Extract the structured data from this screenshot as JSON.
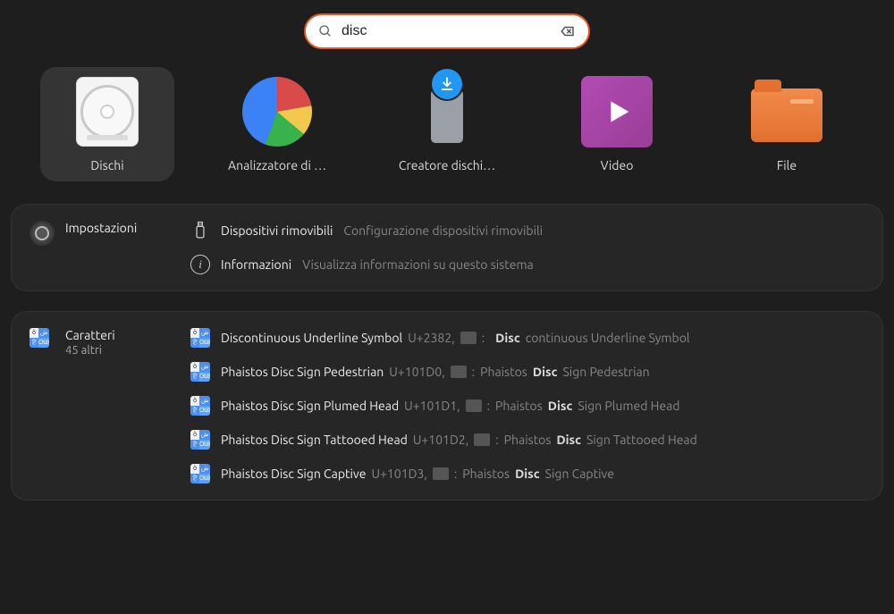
{
  "search": {
    "value": "disc"
  },
  "apps": [
    {
      "label": "Dischi",
      "selected": true,
      "icon": "disks"
    },
    {
      "label": "Analizzatore di …",
      "icon": "disk-usage-analyzer"
    },
    {
      "label": "Creatore dischi…",
      "icon": "startup-disk-creator"
    },
    {
      "label": "Video",
      "icon": "video"
    },
    {
      "label": "File",
      "icon": "files"
    }
  ],
  "settings": {
    "title": "Impostazioni",
    "rows": [
      {
        "icon": "usb",
        "title": "Dispositivi rimovibili",
        "desc": "Configurazione dispositivi rimovibili"
      },
      {
        "icon": "info",
        "title": "Informazioni",
        "desc": "Visualizza informazioni su questo sistema"
      }
    ]
  },
  "characters": {
    "title": "Caratteri",
    "more": "45 altri",
    "rows": [
      {
        "name": "Discontinuous Underline Symbol",
        "code": "U+2382",
        "rest_before": "",
        "rest_after": "continuous Underline Symbol"
      },
      {
        "name": "Phaistos Disc Sign Pedestrian",
        "code": "U+101D0",
        "rest_before": "Phaistos ",
        "rest_after": " Sign Pedestrian"
      },
      {
        "name": "Phaistos Disc Sign Plumed Head",
        "code": "U+101D1",
        "rest_before": "Phaistos ",
        "rest_after": " Sign Plumed Head"
      },
      {
        "name": "Phaistos Disc Sign Tattooed Head",
        "code": "U+101D2",
        "rest_before": "Phaistos ",
        "rest_after": " Sign Tattooed Head"
      },
      {
        "name": "Phaistos Disc Sign Captive",
        "code": "U+101D3",
        "rest_before": "Phaistos ",
        "rest_after": " Sign Captive"
      }
    ],
    "hl": "Disc"
  }
}
